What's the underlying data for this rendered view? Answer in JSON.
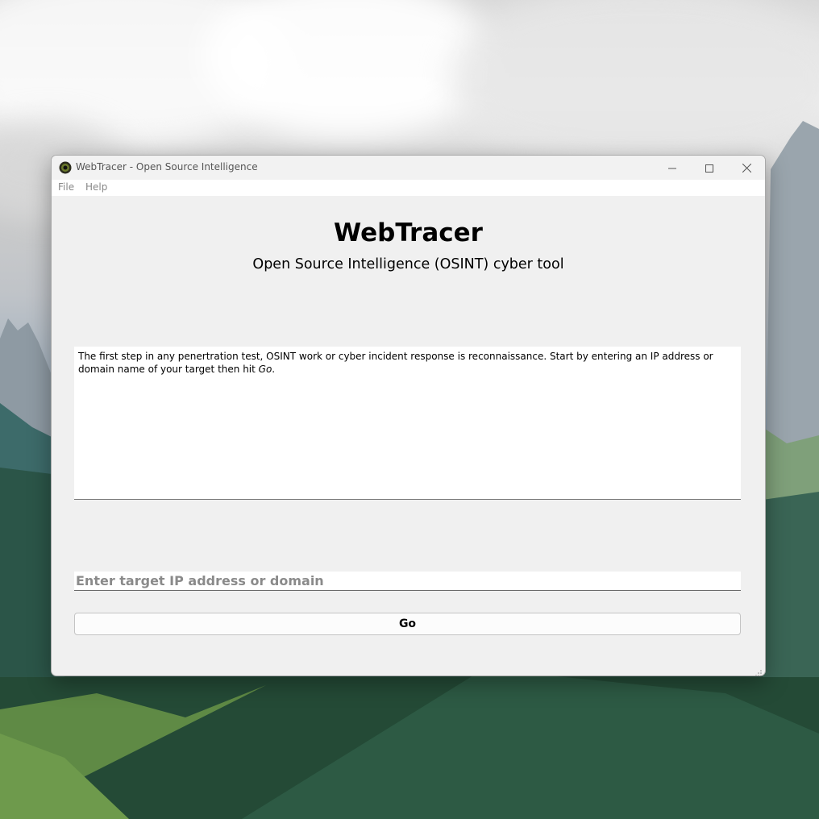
{
  "window": {
    "title": "WebTracer - Open Source Intelligence",
    "app_icon": "webtracer-eye-icon",
    "controls": [
      "minimize-icon",
      "maximize-icon",
      "close-icon"
    ]
  },
  "menubar": {
    "items": [
      {
        "label": "File"
      },
      {
        "label": "Help"
      }
    ]
  },
  "main": {
    "title": "WebTracer",
    "subtitle": "Open Source Intelligence (OSINT) cyber tool",
    "output": {
      "text_before": "The first step in any penertration test, OSINT work or cyber incident response is reconnaissance. Start by entering an IP address or domain name of your target then hit ",
      "emphasis": "Go",
      "text_after": "."
    },
    "target_input": {
      "value": "",
      "placeholder": "Enter target IP address or domain"
    },
    "go_button": {
      "label": "Go"
    }
  }
}
